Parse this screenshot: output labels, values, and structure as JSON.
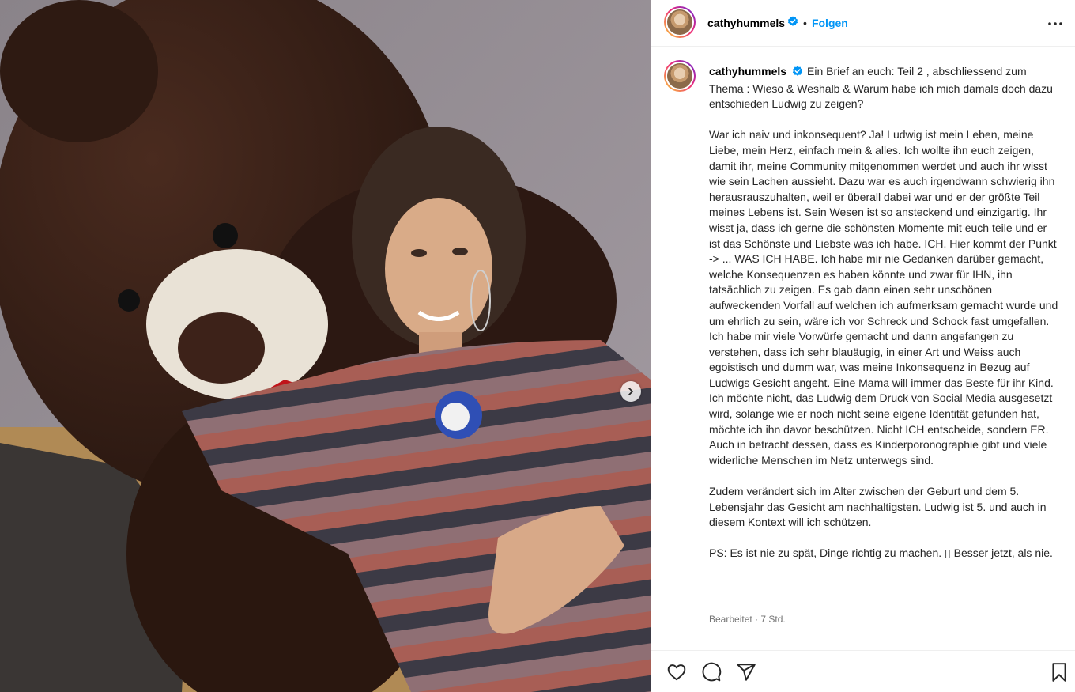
{
  "post": {
    "username": "cathyhummels",
    "follow_label": "Folgen",
    "separator": "•",
    "verified_icon": "verified-badge-icon",
    "more_icon": "more-options-icon"
  },
  "caption": {
    "username": "cathyhummels",
    "text": "Ein Brief an euch: Teil 2 , abschliessend zum Thema : Wieso & Weshalb & Warum habe ich mich damals doch dazu entschieden Ludwig zu zeigen?\n\nWar ich naiv und inkonsequent? Ja! Ludwig ist mein Leben, meine Liebe, mein Herz, einfach mein & alles. Ich wollte ihn euch zeigen, damit ihr, meine Community mitgenommen werdet und auch ihr wisst wie sein Lachen aussieht. Dazu war es auch irgendwann schwierig ihn herausrauszuhalten, weil er überall dabei war und er der größte Teil meines Lebens ist. Sein Wesen ist so ansteckend und einzigartig. Ihr wisst ja, dass ich gerne die schönsten Momente mit euch teile und er ist das Schönste und Liebste was ich habe. ICH. Hier kommt der Punkt -> ... WAS ICH HABE. Ich habe mir nie Gedanken darüber gemacht, welche Konsequenzen es haben könnte und zwar für IHN, ihn tatsächlich zu zeigen. Es gab dann einen sehr unschönen aufweckenden Vorfall auf welchen ich aufmerksam gemacht wurde und um ehrlich zu sein, wäre ich vor Schreck und Schock fast umgefallen. Ich habe mir viele Vorwürfe gemacht und dann angefangen zu verstehen, dass ich sehr blauäugig, in einer Art und Weiss auch egoistisch und dumm war, was meine Inkonsequenz in Bezug auf Ludwigs Gesicht angeht. Eine Mama will immer das Beste für ihr Kind. Ich möchte nicht, das Ludwig dem Druck von Social Media ausgesetzt wird, solange wie er noch nicht seine eigene Identität gefunden hat, möchte ich ihn davor beschützen. Nicht ICH entscheide, sondern ER. Auch in betracht dessen, dass es Kinderporonographie gibt und viele widerliche Menschen im Netz unterwegs sind.\n\nZudem verändert sich im Alter zwischen der Geburt und dem 5. Lebensjahr das Gesicht am nachhaltigsten. Ludwig ist 5. und auch in diesem Kontext will ich schützen.\n\nPS: Es ist nie zu spät, Dinge richtig zu machen. ▯ Besser jetzt, als nie.",
    "meta": "Bearbeitet · 7 Std."
  },
  "actions": {
    "like_icon": "heart-icon",
    "comment_icon": "comment-icon",
    "share_icon": "share-icon",
    "save_icon": "bookmark-icon"
  },
  "colors": {
    "follow": "#0095f6",
    "verified": "#0095f6",
    "meta": "#737373"
  }
}
